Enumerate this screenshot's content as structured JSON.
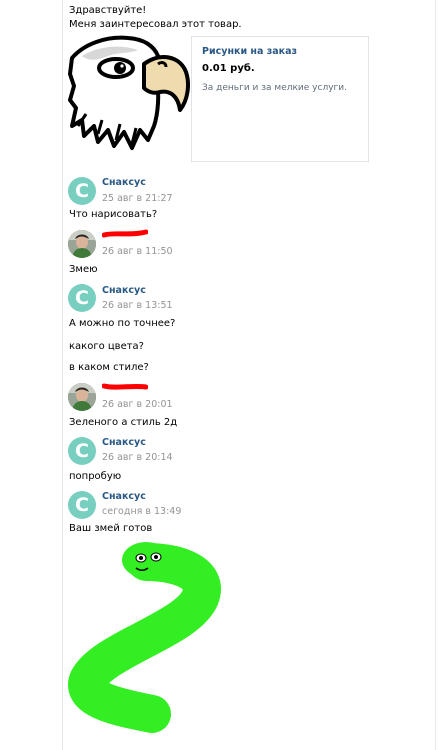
{
  "intro": {
    "greeting": "Здравствуйте!",
    "interest": "Меня заинтересовал этот товар."
  },
  "product_card": {
    "title": "Рисунки на заказ",
    "price": "0.01 руб.",
    "description": "За деньги и за мелкие услуги."
  },
  "messages": [
    {
      "author": "Снаксус",
      "time": "25 авг в 21:27",
      "avatar_letter": "С",
      "lines": [
        "Что нарисовать?"
      ]
    },
    {
      "author": "",
      "time": "26 авг в 11:50",
      "avatar": "user-photo",
      "lines": [
        "Змею"
      ]
    },
    {
      "author": "Снаксус",
      "time": "26 авг в 13:51",
      "avatar_letter": "С",
      "lines": [
        "А можно по точнее?",
        "какого цвета?",
        "в каком стиле?"
      ]
    },
    {
      "author": "",
      "time": "26 авг в 20:01",
      "avatar": "user-photo",
      "lines": [
        "Зеленого а стиль 2д"
      ]
    },
    {
      "author": "Снаксус",
      "time": "26 авг в 20:14",
      "avatar_letter": "С",
      "lines": [
        "попробую"
      ]
    },
    {
      "author": "Снаксус",
      "time": "сегодня в 13:49",
      "avatar_letter": "С",
      "lines": [
        "Ваш змей готов"
      ]
    }
  ],
  "colors": {
    "link": "#2a5885",
    "muted": "#939393",
    "avatar": "#78cfc0",
    "redaction": "#ff0000",
    "snake": "#33ee22"
  }
}
